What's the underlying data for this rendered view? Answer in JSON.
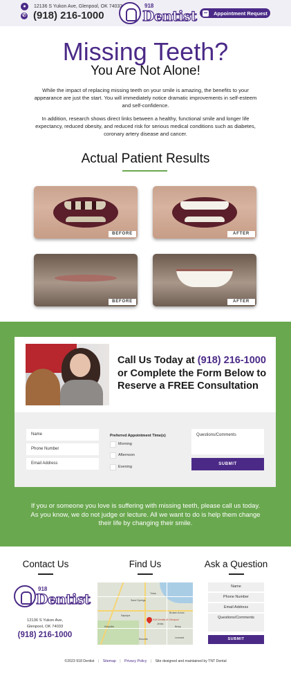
{
  "header": {
    "address": "12136 S Yukon Ave, Glenpool, OK 74033",
    "phone": "(918) 216-1000",
    "logo_number": "918",
    "logo_word": "Dentist",
    "appointment_button": "Appointment Request"
  },
  "hero": {
    "title": "Missing Teeth?",
    "subtitle": "You Are Not Alone!",
    "paragraph1": "While the impact of replacing missing teeth on your smile is amazing, the benefits to your appearance are just the start. You will immediately notice dramatic improvements in self-esteem and self-confidence.",
    "paragraph2": "In addition, research shows direct links between a healthy, functional smile and longer life expectancy, reduced obesity, and reduced risk for serious medical conditions such as diabetes, coronary artery disease and cancer."
  },
  "results": {
    "title": "Actual Patient Results",
    "before_label": "BEFORE",
    "after_label": "AFTER"
  },
  "cta": {
    "line1_text": "Call Us Today at ",
    "line1_phone": "(918) 216-1000",
    "line2": "or Complete the Form Below to",
    "line3": "Reserve a FREE Consultation"
  },
  "form": {
    "name_placeholder": "Name",
    "phone_placeholder": "Phone Number",
    "email_placeholder": "Email Address",
    "preferred_title": "Preferred Appointment Time(s)",
    "options": [
      "Morning",
      "Afternoon",
      "Evening"
    ],
    "comments_placeholder": "Questions/Comments",
    "submit": "SUBMIT"
  },
  "green_paragraph": "If you or someone you love is suffering with missing teeth, please call us today. As you know, we do not judge or lecture. All we want to do is help them change their life by changing their smile.",
  "footer": {
    "contact_title": "Contact Us",
    "find_title": "Find Us",
    "ask_title": "Ask a Question",
    "address_line1": "12136 S Yukon Ave,",
    "address_line2": "Glenpool, OK 74033",
    "phone": "(918) 216-1000",
    "ask_name": "Name",
    "ask_phone": "Phone Number",
    "ask_email": "Email Address",
    "ask_comments": "Questions/Comments",
    "ask_submit": "SUBMIT",
    "map_labels": [
      "Tulsa",
      "Sand Springs",
      "Broken Arrow",
      "Sapulpa",
      "Jenks",
      "Bixby",
      "Kellyville",
      "918 Dentist of Glenpool",
      "Mounds",
      "Leonard"
    ]
  },
  "copyright": {
    "text": "©2023 918 Dentist",
    "sitemap": "Sitemap",
    "privacy": "Privacy Policy",
    "credit": "Site designed and maintained by TNT Dental"
  },
  "colors": {
    "brand_purple": "#4b2a87",
    "green": "#6aa84f",
    "header_bg": "#f1eff6"
  }
}
